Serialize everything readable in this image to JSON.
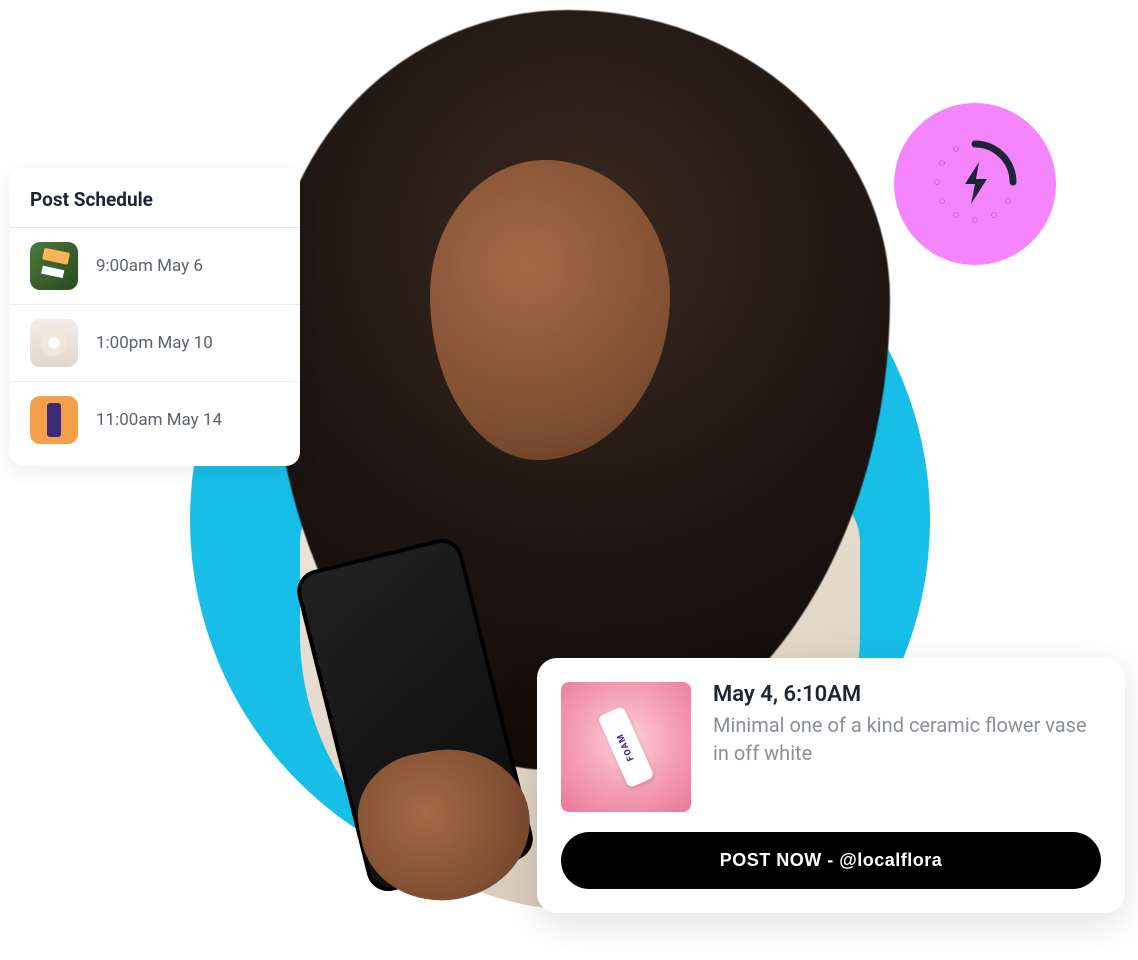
{
  "schedule": {
    "title": "Post Schedule",
    "items": [
      {
        "thumb_class": "thumb-1",
        "time": "9:00am May 6"
      },
      {
        "thumb_class": "thumb-2",
        "time": "1:00pm May 10"
      },
      {
        "thumb_class": "thumb-3",
        "time": "11:00am May 14"
      }
    ]
  },
  "post": {
    "date": "May 4, 6:10AM",
    "description": "Minimal one of a kind ceramic flower vase in off white",
    "button_label": "POST NOW - @localflora"
  },
  "badge": {
    "icon": "lightning-loading-icon"
  }
}
